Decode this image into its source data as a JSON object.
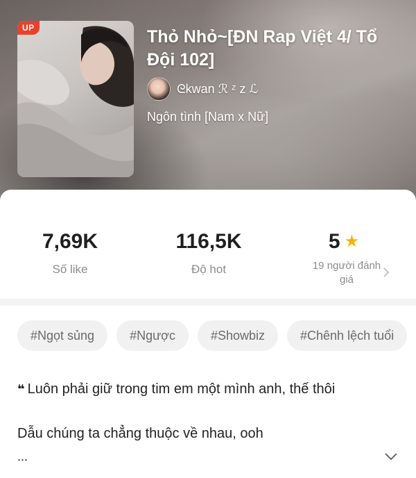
{
  "book": {
    "badge": "UP",
    "title": "Thỏ Nhỏ~[ĐN Rap Việt 4/ Tổ Đội 102]",
    "author": "ᘓkwan ℛ ᶻ z ℒ",
    "genre": "Ngôn tình [Nam x Nữ]"
  },
  "stats": {
    "likes": {
      "value": "7,69K",
      "label": "Số like"
    },
    "hot": {
      "value": "116,5K",
      "label": "Độ hot"
    },
    "rating": {
      "value": "5",
      "raters": "19 người đánh giá"
    }
  },
  "tags": [
    "#Ngọt sủng",
    "#Ngược",
    "#Showbiz",
    "#Chênh lệch tuổi"
  ],
  "description": {
    "quote_mark": "❝",
    "quote": "Luôn phải giữ trong tim em một mình anh, thế thôi",
    "line2": "Dẫu chúng ta chẳng thuộc về nhau, ooh",
    "ellipsis": "..."
  },
  "icons": {
    "star": "star-icon",
    "chevron_right": "chevron-right-icon",
    "chevron_down": "chevron-down-icon"
  },
  "colors": {
    "badge": "#e8412f",
    "star": "#f5b400",
    "tag_bg": "#f1f1f1"
  }
}
